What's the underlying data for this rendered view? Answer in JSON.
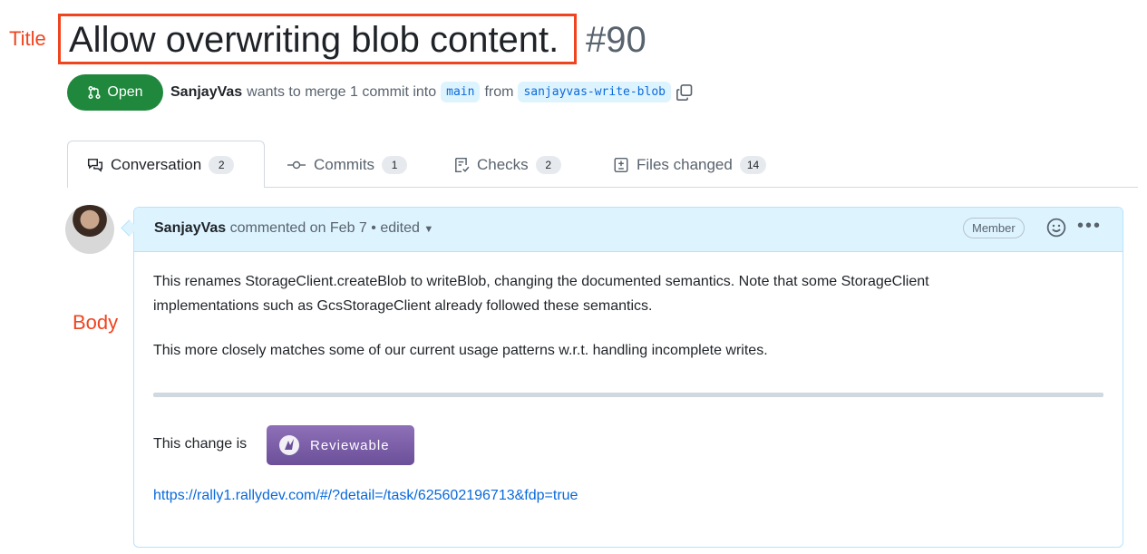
{
  "annotations": {
    "title_label": "Title",
    "body_label": "Body"
  },
  "pr": {
    "title": "Allow overwriting blob content.",
    "number": "#90",
    "status": "Open",
    "author": "SanjayVas",
    "merge_text": "wants to merge 1 commit into",
    "base_branch": "main",
    "from_text": "from",
    "head_branch": "sanjayvas-write-blob"
  },
  "tabs": [
    {
      "label": "Conversation",
      "count": "2",
      "icon": "comment-discussion-icon",
      "active": true
    },
    {
      "label": "Commits",
      "count": "1",
      "icon": "git-commit-icon",
      "active": false
    },
    {
      "label": "Checks",
      "count": "2",
      "icon": "checklist-icon",
      "active": false
    },
    {
      "label": "Files changed",
      "count": "14",
      "icon": "file-diff-icon",
      "active": false
    }
  ],
  "comment": {
    "author": "SanjayVas",
    "meta": "commented on Feb 7 • edited",
    "role_badge": "Member",
    "body_line1": "This renames StorageClient.createBlob to writeBlob, changing the documented semantics. Note that some StorageClient",
    "body_line2": "implementations such as GcsStorageClient already followed these semantics.",
    "body_line3": "This more closely matches some of our current usage patterns w.r.t. handling incomplete writes.",
    "change_text": "This change is",
    "reviewable_label": "Reviewable",
    "link": "https://rally1.rallydev.com/#/?detail=/task/625602196713&fdp=true"
  },
  "colors": {
    "annotation": "#f0441f",
    "open_green": "#1f883d",
    "link_blue": "#0969da",
    "header_blue": "#ddf4ff"
  }
}
